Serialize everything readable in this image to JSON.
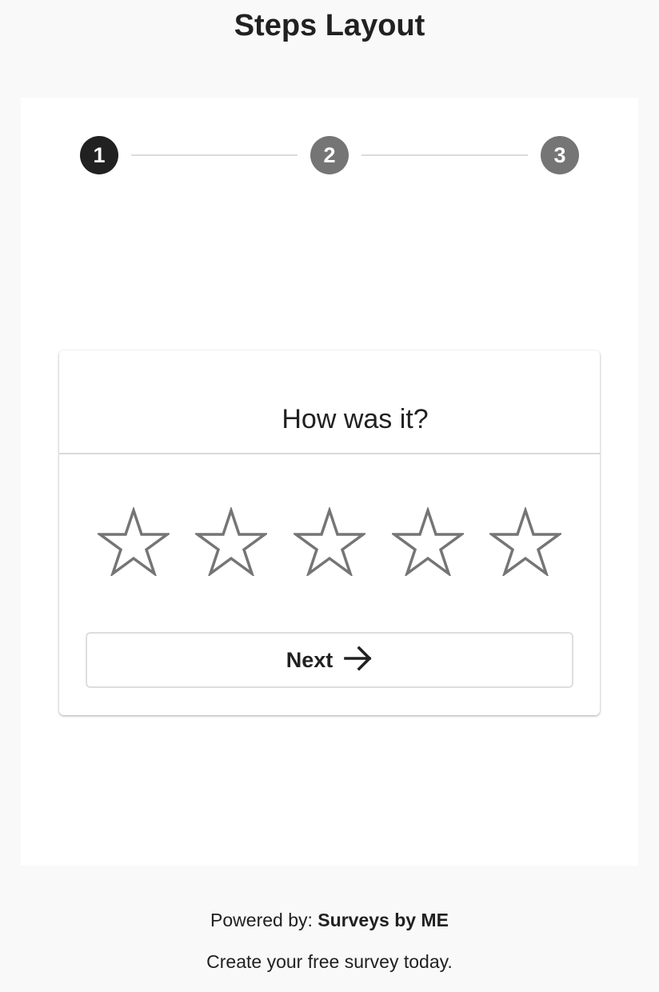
{
  "page": {
    "title": "Steps Layout"
  },
  "stepper": {
    "steps": [
      {
        "label": "1",
        "active": true
      },
      {
        "label": "2",
        "active": false
      },
      {
        "label": "3",
        "active": false
      }
    ]
  },
  "card": {
    "question": "How was it?",
    "rating": {
      "max": 5,
      "selected": 0,
      "icon": "star-outline-icon"
    },
    "next_label": "Next",
    "next_icon": "arrow-right-icon"
  },
  "footer": {
    "powered_by_prefix": "Powered by:",
    "powered_by_brand": "Surveys by ME",
    "tagline": "Create your free survey today."
  },
  "colors": {
    "background": "#f9f9f9",
    "active_step": "#212121",
    "inactive_step": "#757575",
    "star_outline": "#757575"
  }
}
